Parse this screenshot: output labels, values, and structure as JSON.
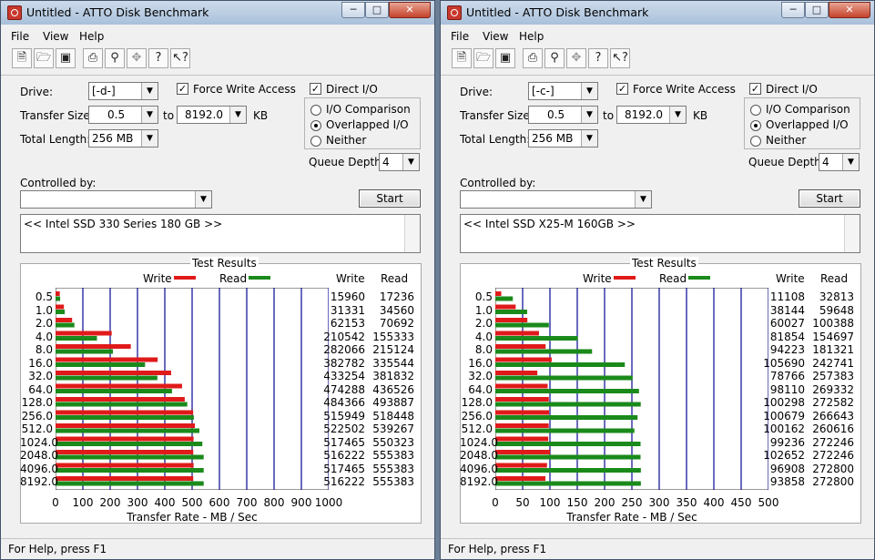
{
  "windows": [
    {
      "title": "Untitled - ATTO Disk Benchmark",
      "menu": [
        "File",
        "View",
        "Help"
      ],
      "drive_label": "Drive:",
      "drive_value": "[-d-]",
      "force_write_label": "Force Write Access",
      "force_write_checked": true,
      "direct_io_label": "Direct I/O",
      "direct_io_checked": true,
      "transfer_size_label": "Transfer Size:",
      "transfer_from": "0.5",
      "to_label": "to",
      "transfer_to": "8192.0",
      "kb_label": "KB",
      "total_length_label": "Total Length:",
      "total_length_value": "256 MB",
      "io_options": [
        "I/O Comparison",
        "Overlapped I/O",
        "Neither"
      ],
      "io_selected": "Overlapped I/O",
      "queue_depth_label": "Queue Depth:",
      "queue_depth_value": "4",
      "controlled_by_label": "Controlled by:",
      "controlled_by_value": "",
      "start_label": "Start",
      "description": "<< Intel SSD 330 Series 180 GB >>",
      "results_title": "Test Results",
      "write_legend": "Write",
      "read_legend": "Read",
      "col_write": "Write",
      "col_read": "Read",
      "status": "For Help, press F1",
      "chart_data": {
        "type": "bar",
        "categories": [
          "0.5",
          "1.0",
          "2.0",
          "4.0",
          "8.0",
          "16.0",
          "32.0",
          "64.0",
          "128.0",
          "256.0",
          "512.0",
          "1024.0",
          "2048.0",
          "4096.0",
          "8192.0"
        ],
        "series": [
          {
            "name": "Write",
            "values": [
              15960,
              31331,
              62153,
              210542,
              282066,
              382782,
              433254,
              474288,
              484366,
              515949,
              522502,
              517465,
              516222,
              517465,
              516222
            ]
          },
          {
            "name": "Read",
            "values": [
              17236,
              34560,
              70692,
              155333,
              215124,
              335544,
              381832,
              436526,
              493887,
              518448,
              539267,
              550323,
              555383,
              555383,
              555383
            ]
          }
        ],
        "xlim": [
          0,
          1000
        ],
        "xticks": [
          "0",
          "100",
          "200",
          "300",
          "400",
          "500",
          "600",
          "700",
          "800",
          "900",
          "1000"
        ],
        "xlabel": "Transfer Rate - MB / Sec",
        "grid": true
      }
    },
    {
      "title": "Untitled - ATTO Disk Benchmark",
      "menu": [
        "File",
        "View",
        "Help"
      ],
      "drive_label": "Drive:",
      "drive_value": "[-c-]",
      "force_write_label": "Force Write Access",
      "force_write_checked": true,
      "direct_io_label": "Direct I/O",
      "direct_io_checked": true,
      "transfer_size_label": "Transfer Size:",
      "transfer_from": "0.5",
      "to_label": "to",
      "transfer_to": "8192.0",
      "kb_label": "KB",
      "total_length_label": "Total Length:",
      "total_length_value": "256 MB",
      "io_options": [
        "I/O Comparison",
        "Overlapped I/O",
        "Neither"
      ],
      "io_selected": "Overlapped I/O",
      "queue_depth_label": "Queue Depth:",
      "queue_depth_value": "4",
      "controlled_by_label": "Controlled by:",
      "controlled_by_value": "",
      "start_label": "Start",
      "description": "<< Intel SSD X25-M 160GB >>",
      "results_title": "Test Results",
      "write_legend": "Write",
      "read_legend": "Read",
      "col_write": "Write",
      "col_read": "Read",
      "status": "For Help, press F1",
      "chart_data": {
        "type": "bar",
        "categories": [
          "0.5",
          "1.0",
          "2.0",
          "4.0",
          "8.0",
          "16.0",
          "32.0",
          "64.0",
          "128.0",
          "256.0",
          "512.0",
          "1024.0",
          "2048.0",
          "4096.0",
          "8192.0"
        ],
        "series": [
          {
            "name": "Write",
            "values": [
              11108,
              38144,
              60027,
              81854,
              94223,
              105690,
              78766,
              98110,
              100298,
              100679,
              100162,
              99236,
              102652,
              96908,
              93858
            ]
          },
          {
            "name": "Read",
            "values": [
              32813,
              59648,
              100388,
              154697,
              181321,
              242741,
              257383,
              269332,
              272582,
              266643,
              260616,
              272246,
              272246,
              272800,
              272800
            ]
          }
        ],
        "xlim": [
          0,
          500
        ],
        "xticks": [
          "0",
          "50",
          "100",
          "150",
          "200",
          "250",
          "300",
          "350",
          "400",
          "450",
          "500"
        ],
        "xlabel": "Transfer Rate - MB / Sec",
        "grid": true
      }
    }
  ],
  "colors": {
    "write_bar": "#e01a1a",
    "read_bar": "#1a8a1a",
    "grid_line": "#1a1a9a"
  },
  "icons": [
    "new-file-icon",
    "open-folder-icon",
    "save-icon",
    "print-icon",
    "print-preview-icon",
    "move-icon",
    "help-icon",
    "context-help-icon"
  ]
}
